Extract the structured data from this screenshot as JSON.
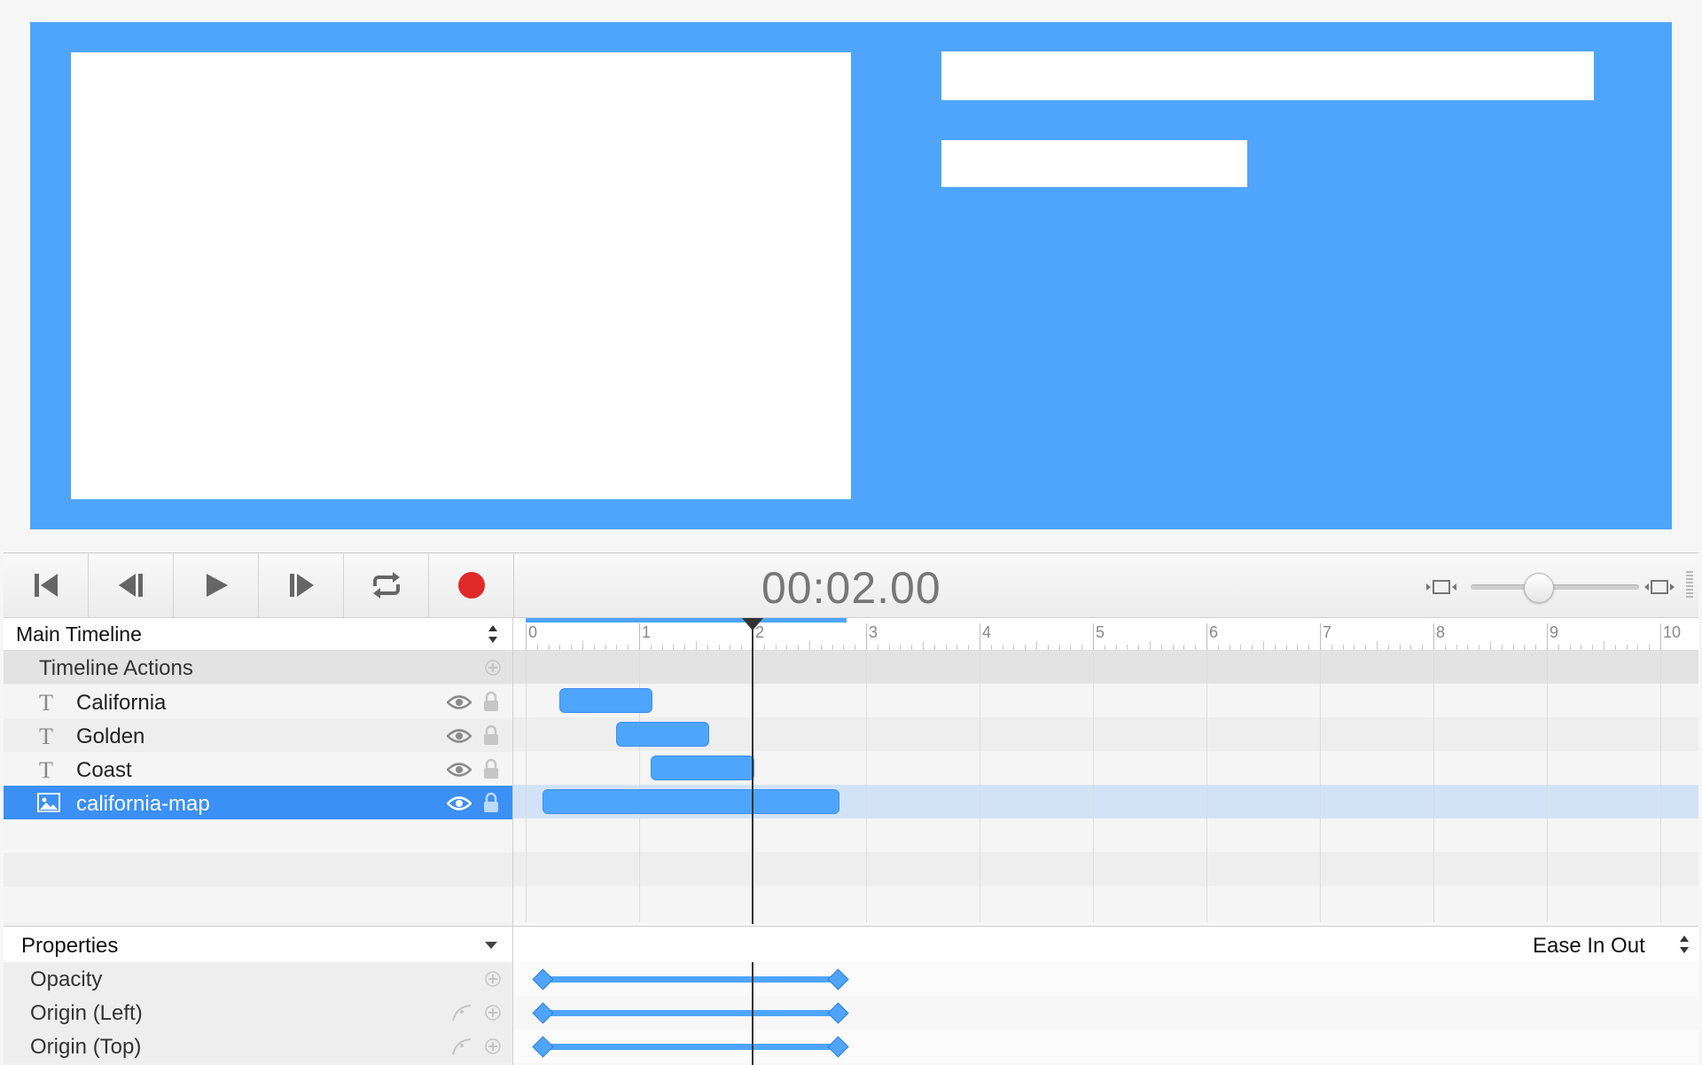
{
  "toolbar": {
    "timecode": "00:02.00",
    "buttons": [
      "go-to-start",
      "step-back",
      "play",
      "step-forward",
      "loop",
      "record"
    ],
    "record_color": "#e02a2a",
    "zoom_level": 0.4
  },
  "timeline": {
    "name": "Main Timeline",
    "actions_label": "Timeline Actions",
    "ruler_ticks": [
      "0",
      "1",
      "2",
      "3",
      "4",
      "5",
      "6",
      "7",
      "8",
      "9",
      "10"
    ],
    "playhead_seconds": 2.0,
    "layers": [
      {
        "name": "California",
        "type": "text",
        "start": 0.3,
        "end": 1.1,
        "selected": false
      },
      {
        "name": "Golden",
        "type": "text",
        "start": 0.8,
        "end": 1.6,
        "selected": false
      },
      {
        "name": "Coast",
        "type": "text",
        "start": 1.1,
        "end": 2.0,
        "selected": false
      },
      {
        "name": "california-map",
        "type": "image",
        "start": 0.15,
        "end": 2.75,
        "selected": true
      }
    ]
  },
  "properties": {
    "label": "Properties",
    "easing": "Ease In Out",
    "rows": [
      {
        "name": "Opacity",
        "has_curve": false,
        "start": 0.15,
        "end": 2.75
      },
      {
        "name": "Origin (Left)",
        "has_curve": true,
        "start": 0.15,
        "end": 2.75
      },
      {
        "name": "Origin (Top)",
        "has_curve": true,
        "start": 0.15,
        "end": 2.75
      }
    ]
  },
  "colors": {
    "accent": "#4ea5fb",
    "selection": "#3b8ff5"
  }
}
